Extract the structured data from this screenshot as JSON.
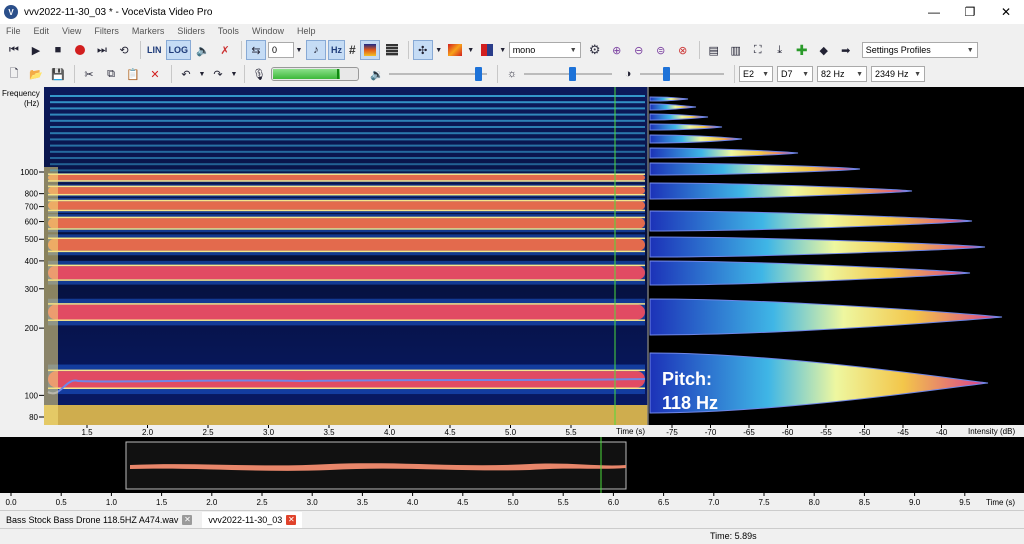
{
  "window": {
    "title": "vvv2022-11-30_03 * - VoceVista Video Pro",
    "app_icon": "V",
    "minimize": "—",
    "maximize": "❐",
    "close": "✕"
  },
  "menu": [
    "File",
    "Edit",
    "View",
    "Filters",
    "Markers",
    "Sliders",
    "Tools",
    "Window",
    "Help"
  ],
  "toolbar1": {
    "lin_label": "LIN",
    "log_label": "LOG",
    "loop_count": "0",
    "hz_label": "Hz",
    "sharp_label": "#",
    "channel_select": "mono",
    "settings_profiles": "Settings Profiles"
  },
  "toolbar2": {
    "input_level": 0.78,
    "volume_level": 0.95,
    "brightness_level": 0.55,
    "contrast_level": 0.3,
    "note_low": "E2",
    "note_high": "D7",
    "freq_low": "82 Hz",
    "freq_high": "2349 Hz"
  },
  "spectrogram": {
    "freq_axis_label_1": "Frequency",
    "freq_axis_label_2": "(Hz)",
    "freq_ticks": [
      "1000",
      "800",
      "700",
      "600",
      "500",
      "400",
      "300",
      "200",
      "100",
      "80"
    ],
    "time_ticks": [
      "1.5",
      "2.0",
      "2.5",
      "3.0",
      "3.5",
      "4.0",
      "4.5",
      "5.0",
      "5.5"
    ],
    "time_unit": "Time (s)"
  },
  "spectrum": {
    "intensity_ticks": [
      "-75",
      "-70",
      "-65",
      "-60",
      "-55",
      "-50",
      "-45",
      "-40"
    ],
    "intensity_unit": "Intensity (dB)",
    "pitch_label": "Pitch:",
    "pitch_value": "118 Hz"
  },
  "overview": {
    "time_ticks": [
      "0.0",
      "0.5",
      "1.0",
      "1.5",
      "2.0",
      "2.5",
      "3.0",
      "3.5",
      "4.0",
      "4.5",
      "5.0",
      "5.5",
      "6.0",
      "6.5",
      "7.0",
      "7.5",
      "8.0",
      "8.5",
      "9.0",
      "9.5"
    ],
    "time_unit": "Time (s)"
  },
  "tabs": [
    {
      "label": "Bass Stock  Bass Drone 118.5HZ A474.wav",
      "close_color": "#9a9a9a"
    },
    {
      "label": "vvv2022-11-30_03",
      "close_color": "#e0432b"
    }
  ],
  "status": {
    "time": "Time:  5.89s"
  },
  "colors": {
    "accent": "#1d72d8",
    "pitch_line": "#6f86e8",
    "cursor": "#4bdc3c",
    "waveform": "#e8866a"
  }
}
